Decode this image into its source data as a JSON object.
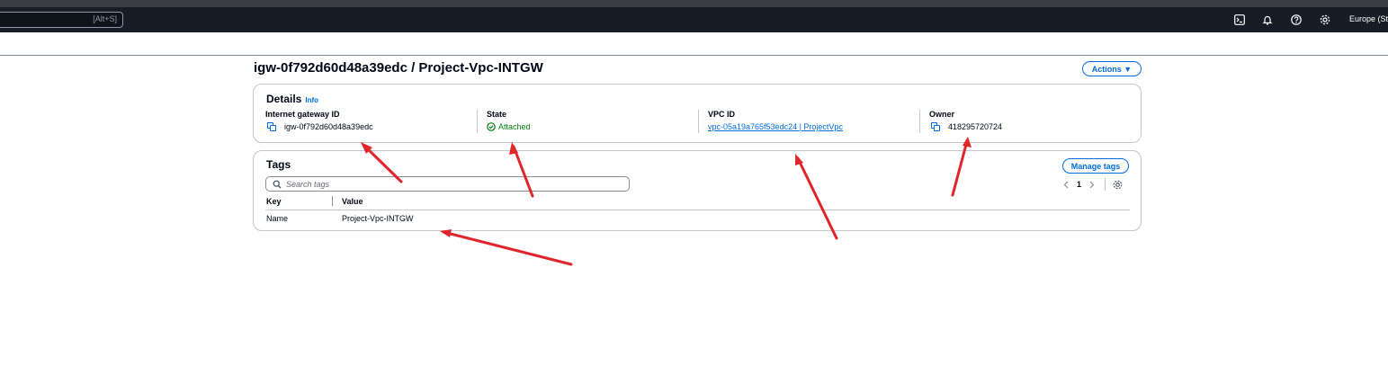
{
  "topbar": {
    "search_shortcut": "[Alt+S]",
    "icons": [
      "cloudshell-icon",
      "bell-icon",
      "help-icon",
      "gear-icon"
    ],
    "region": "Europe (Stoc"
  },
  "page": {
    "title": "igw-0f792d60d48a39edc / Project-Vpc-INTGW",
    "actions_label": "Actions ▼"
  },
  "details": {
    "title": "Details",
    "info_label": "Info",
    "fields": {
      "igw_label": "Internet gateway ID",
      "igw_value": "igw-0f792d60d48a39edc",
      "state_label": "State",
      "state_value": "Attached",
      "vpc_label": "VPC ID",
      "vpc_value": "vpc-05a19a765f53edc24 | ProjectVpc",
      "owner_label": "Owner",
      "owner_value": "418295720724"
    }
  },
  "tags": {
    "title": "Tags",
    "manage_label": "Manage tags",
    "search_placeholder": "Search tags",
    "page_number": "1",
    "columns": [
      "Key",
      "Value"
    ],
    "rows": [
      {
        "key": "Name",
        "value": "Project-Vpc-INTGW"
      }
    ]
  },
  "colors": {
    "accent": "#006ce0",
    "success": "#037f0c",
    "header_bg": "#161d26",
    "annotation_arrow": "#e0252b"
  }
}
